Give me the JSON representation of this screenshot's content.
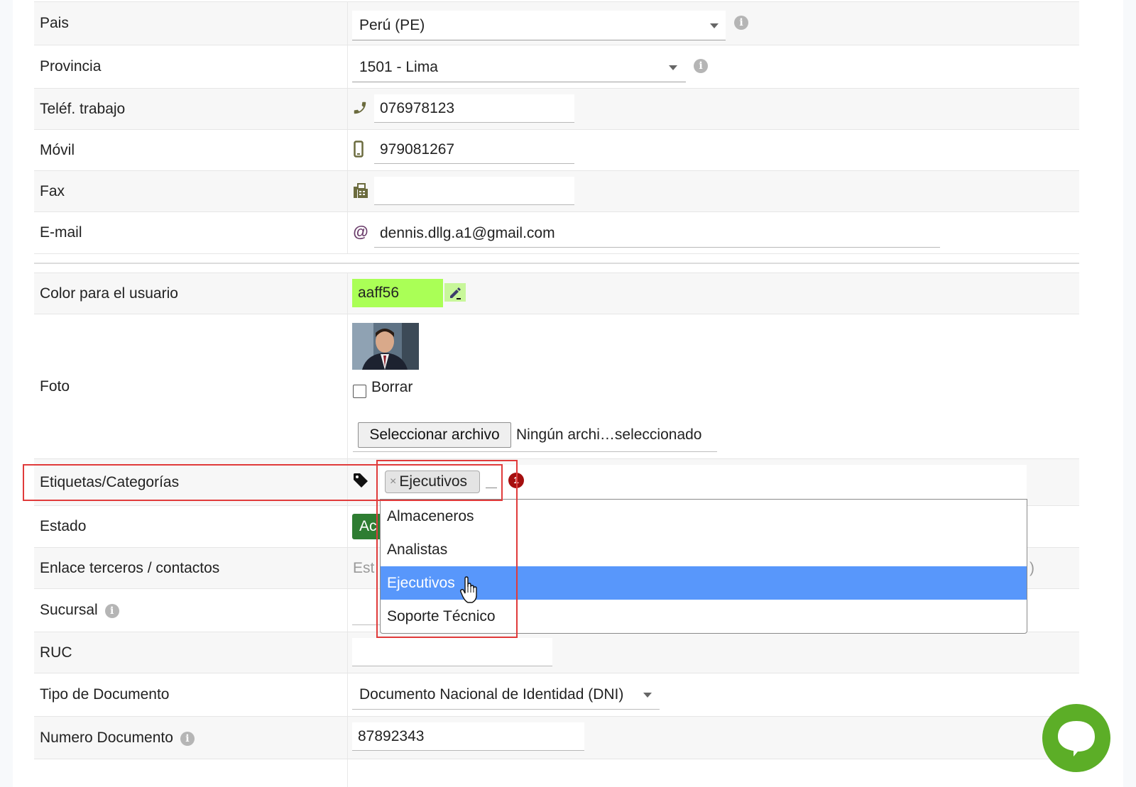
{
  "form": {
    "pais": {
      "label": "Pais",
      "value": "Perú (PE)"
    },
    "provincia": {
      "label": "Provincia",
      "value": "1501 - Lima"
    },
    "telefono_trabajo": {
      "label": "Teléf. trabajo",
      "value": "076978123"
    },
    "movil": {
      "label": "Móvil",
      "value": "979081267"
    },
    "fax": {
      "label": "Fax",
      "value": ""
    },
    "email": {
      "label": "E-mail",
      "value": "dennis.dllg.a1@gmail.com"
    },
    "color_usuario": {
      "label": "Color para el usuario",
      "value": "aaff56",
      "color": "#aaff56"
    },
    "foto": {
      "label": "Foto",
      "borrar_label": "Borrar",
      "file_button": "Seleccionar archivo",
      "file_status": "Ningún archi…seleccionado"
    },
    "etiquetas": {
      "label": "Etiquetas/Categorías",
      "selected_chip": "Ejecutivos",
      "chip_remove": "×",
      "badge_count": "1"
    },
    "estado": {
      "label": "Estado",
      "value_partial": "Ac"
    },
    "enlace_terceros": {
      "label": "Enlace terceros / contactos",
      "value_partial": "Est",
      "trailing": ")"
    },
    "sucursal": {
      "label": "Sucursal"
    },
    "ruc": {
      "label": "RUC",
      "value": ""
    },
    "tipo_documento": {
      "label": "Tipo de Documento",
      "value": "Documento Nacional de Identidad (DNI)"
    },
    "numero_documento": {
      "label": "Numero Documento",
      "value": "87892343"
    }
  },
  "dropdown": {
    "options": [
      "Almaceneros",
      "Analistas",
      "Ejecutivos",
      "Soporte Técnico"
    ],
    "highlighted": "Ejecutivos"
  },
  "colors": {
    "highlight": "#5897fb",
    "estado_button": "#2e7d32",
    "badge": "#a50f0f",
    "annotation_box": "#e03b3b",
    "chat_bubble": "#5cae27"
  },
  "icons": [
    "info-icon",
    "phone-icon",
    "mobile-icon",
    "fax-icon",
    "at-icon",
    "pencil-icon",
    "tag-icon",
    "hand-cursor-icon",
    "chat-icon"
  ]
}
